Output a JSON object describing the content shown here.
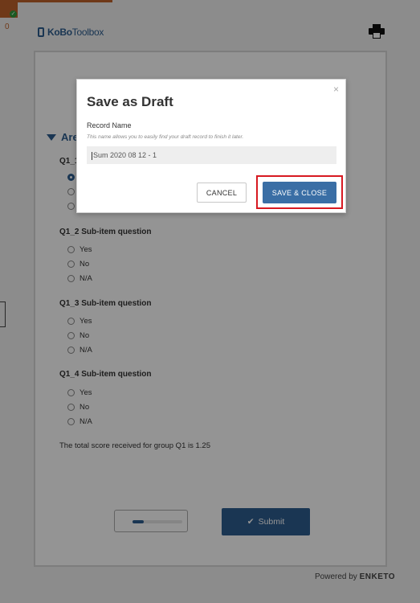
{
  "header": {
    "logo_bold": "KoBo",
    "logo_light": "Toolbox",
    "badge_count": "0",
    "print_icon": "printer-icon"
  },
  "form": {
    "group_label": "Are",
    "questions": [
      {
        "label": "Q1_1"
      },
      {
        "label": "Q1_2 Sub-item question",
        "options": [
          "Yes",
          "No",
          "N/A"
        ]
      },
      {
        "label": "Q1_3 Sub-item question",
        "options": [
          "Yes",
          "No",
          "N/A"
        ]
      },
      {
        "label": "Q1_4 Sub-item question",
        "options": [
          "Yes",
          "No",
          "N/A"
        ]
      }
    ],
    "score_text": "The total score received for group Q1 is 1.25",
    "submit_label": "Submit",
    "submit_icon": "check-icon",
    "powered_by": "Powered by",
    "powered_brand": "ENKETO"
  },
  "dialog": {
    "title": "Save as Draft",
    "close_symbol": "×",
    "field_label": "Record Name",
    "hint": "This name allows you to easily find your draft record to finish it later.",
    "input_value": "Sum 2020 08 12 - 1",
    "cancel_label": "CANCEL",
    "save_label": "SAVE & CLOSE",
    "accent_color": "#3a6ea5",
    "highlight_color": "#d71921"
  }
}
